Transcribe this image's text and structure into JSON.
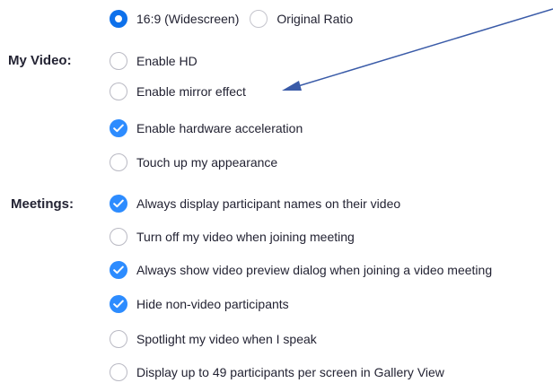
{
  "aspect_ratio": {
    "options": [
      {
        "label": "16:9 (Widescreen)",
        "selected": true
      },
      {
        "label": "Original Ratio",
        "selected": false
      }
    ]
  },
  "my_video": {
    "label": "My Video:",
    "options": [
      {
        "label": "Enable HD",
        "checked": false
      },
      {
        "label": "Enable mirror effect",
        "checked": false
      },
      {
        "label": "Enable hardware acceleration",
        "checked": true
      },
      {
        "label": "Touch up my appearance",
        "checked": false
      }
    ]
  },
  "meetings": {
    "label": "Meetings:",
    "options": [
      {
        "label": "Always display participant names on their video",
        "checked": true
      },
      {
        "label": "Turn off my video when joining meeting",
        "checked": false
      },
      {
        "label": "Always show video preview dialog when joining a video meeting",
        "checked": true
      },
      {
        "label": "Hide non-video participants",
        "checked": true
      },
      {
        "label": "Spotlight my video when I speak",
        "checked": false
      },
      {
        "label": "Display up to 49 participants per screen in Gallery View",
        "checked": false
      }
    ]
  },
  "annotation": {
    "arrow_color": "#3a5ba8",
    "points_to": "Enable mirror effect"
  },
  "colors": {
    "accent": "#2d8cff",
    "text": "#232333",
    "unchecked_border": "#b9b9c3"
  }
}
